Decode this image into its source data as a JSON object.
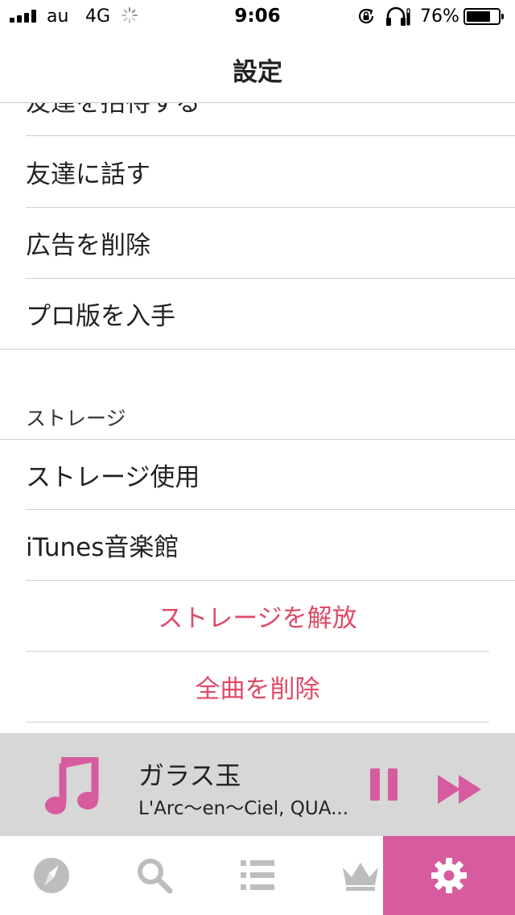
{
  "status_bar": {
    "carrier": "au",
    "network": "4G",
    "time": "9:06",
    "battery_percent": "76%",
    "battery_level": 0.76
  },
  "nav": {
    "title": "設定"
  },
  "list": {
    "partial_row": "友達を招待する",
    "rows_top": [
      "友達に話す",
      "広告を削除",
      "プロ版を入手"
    ],
    "storage_header": "ストレージ",
    "storage_rows": [
      "ストレージ使用",
      "iTunes音楽館"
    ],
    "destructive_rows": [
      "ストレージを解放",
      "全曲を削除"
    ]
  },
  "player": {
    "title": "ガラス玉",
    "artist": "L'Arc〜en〜Ciel, QUA...",
    "accent_color": "#d65c9f"
  },
  "tab_bar": {
    "tabs": [
      {
        "icon": "compass-icon",
        "active": false
      },
      {
        "icon": "search-icon",
        "active": false
      },
      {
        "icon": "list-icon",
        "active": false
      },
      {
        "icon": "crown-icon",
        "active": false
      },
      {
        "icon": "gear-icon",
        "active": true
      }
    ],
    "active_color": "#d65c9f",
    "inactive_color": "#bdbdbd"
  },
  "colors": {
    "destructive": "#e04a68"
  }
}
